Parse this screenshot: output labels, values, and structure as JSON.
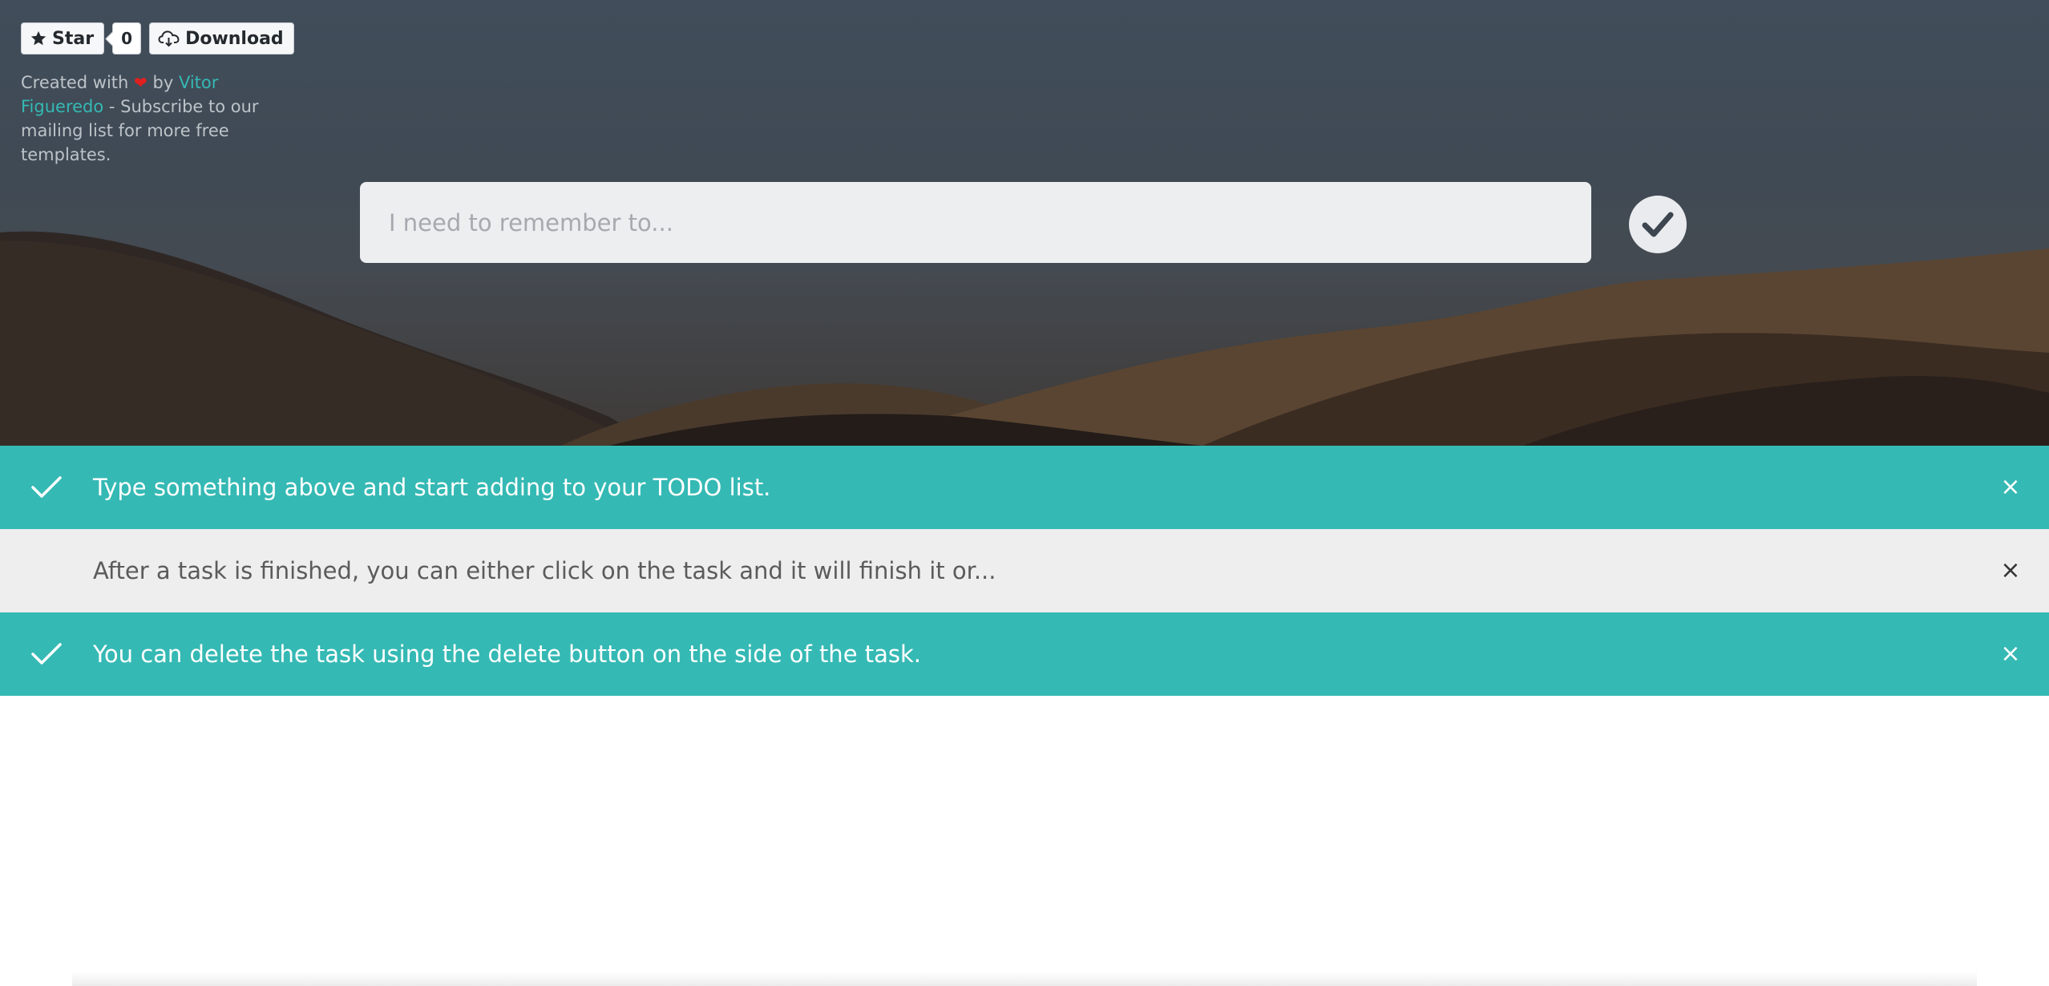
{
  "github": {
    "star_label": "Star",
    "star_count": "0",
    "download_label": "Download"
  },
  "credit": {
    "prefix": "Created with",
    "heart": "❤",
    "by": "by",
    "author": "Vitor Figueredo",
    "suffix": "- Subscribe to our mailing list for more free templates."
  },
  "input": {
    "placeholder": "I need to remember to...",
    "value": ""
  },
  "todos": [
    {
      "text": "Type something above and start adding to your TODO list.",
      "done": true
    },
    {
      "text": "After a task is finished, you can either click on the task and it will finish it or...",
      "done": false
    },
    {
      "text": "You can delete the task using the delete button on the side of the task.",
      "done": true
    }
  ],
  "delete_glyph": "×",
  "colors": {
    "accent": "#35b9b4",
    "open_row": "#eeeeee",
    "hero_sky": "#414d5a",
    "heart": "#e0201f"
  },
  "icons": {
    "star": "star-icon",
    "download": "cloud-download-icon",
    "add": "checkmark-icon",
    "done": "checkmark-icon",
    "delete": "close-icon"
  }
}
